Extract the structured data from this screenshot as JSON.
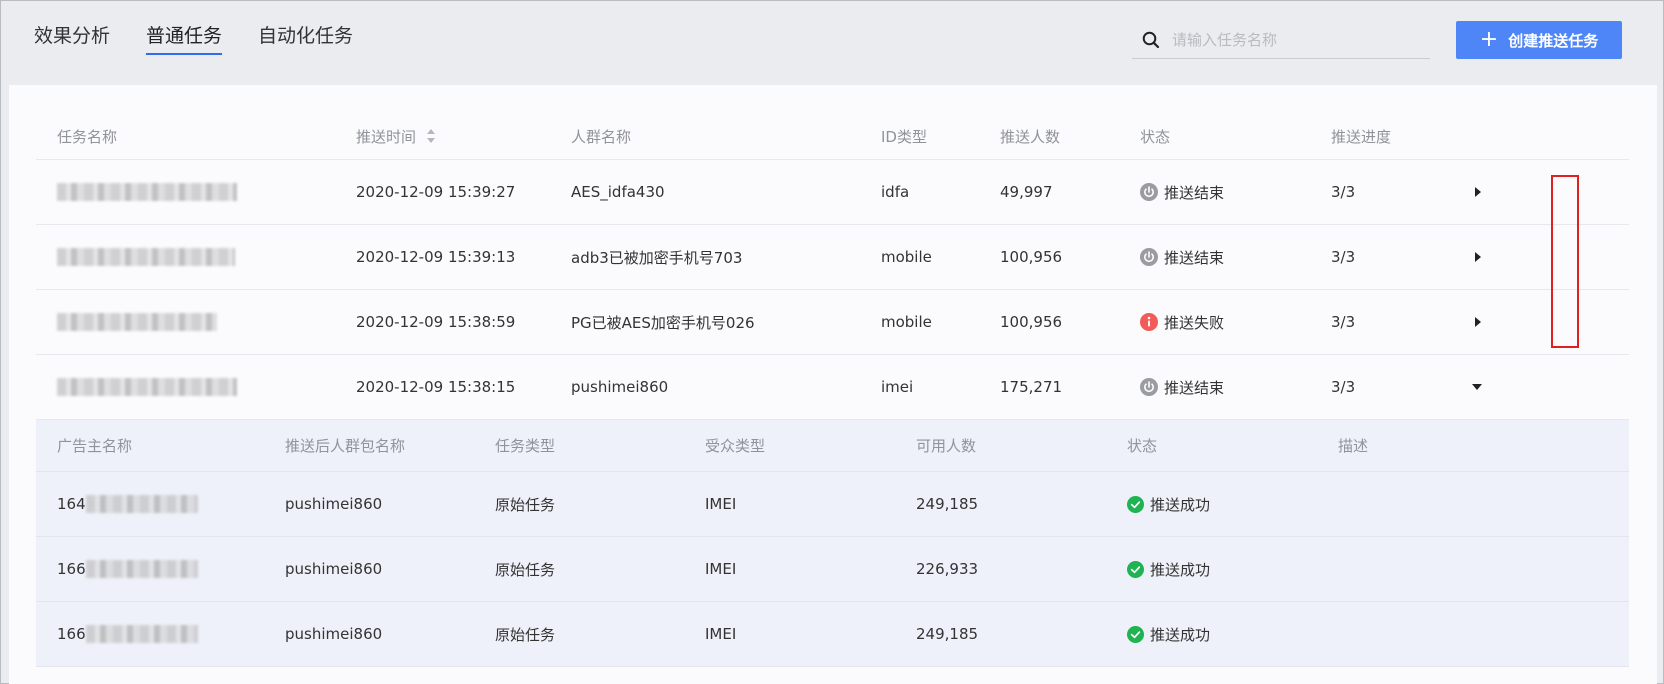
{
  "tabs": [
    {
      "label": "效果分析",
      "active": false
    },
    {
      "label": "普通任务",
      "active": true
    },
    {
      "label": "自动化任务",
      "active": false
    }
  ],
  "search": {
    "placeholder": "请输入任务名称",
    "value": ""
  },
  "create_button": {
    "label": "创建推送任务",
    "icon": "plus-icon"
  },
  "colors": {
    "accent": "#4f86f7",
    "tab_underline": "#2d6cf6",
    "success": "#20b352",
    "fail": "#f35b5b",
    "ended": "#9a9ca1",
    "highlight": "#e02020"
  },
  "table": {
    "headers": [
      "任务名称",
      "推送时间",
      "人群名称",
      "ID类型",
      "推送人数",
      "状态",
      "推送进度"
    ],
    "rows": [
      {
        "name_redacted": true,
        "time": "2020-12-09 15:39:27",
        "audience": "AES_idfa430",
        "id_type": "idfa",
        "count": "49,997",
        "status": "推送结束",
        "status_icon": "power-icon",
        "progress": "3/3",
        "expanded": false
      },
      {
        "name_redacted": true,
        "time": "2020-12-09 15:39:13",
        "audience": "adb3已被加密手机号703",
        "id_type": "mobile",
        "count": "100,956",
        "status": "推送结束",
        "status_icon": "power-icon",
        "progress": "3/3",
        "expanded": false
      },
      {
        "name_redacted": true,
        "time": "2020-12-09 15:38:59",
        "audience": "PG已被AES加密手机号026",
        "id_type": "mobile",
        "count": "100,956",
        "status": "推送失败",
        "status_icon": "error-icon",
        "progress": "3/3",
        "expanded": false
      },
      {
        "name_redacted": true,
        "time": "2020-12-09 15:38:15",
        "audience": "pushimei860",
        "id_type": "imei",
        "count": "175,271",
        "status": "推送结束",
        "status_icon": "power-icon",
        "progress": "3/3",
        "expanded": true
      }
    ]
  },
  "subtable": {
    "headers": [
      "广告主名称",
      "推送后人群包名称",
      "任务类型",
      "受众类型",
      "可用人数",
      "状态",
      "描述"
    ],
    "rows": [
      {
        "advertiser_prefix": "164",
        "package": "pushimei860",
        "task_type": "原始任务",
        "audience_type": "IMEI",
        "available": "249,185",
        "status": "推送成功",
        "desc": ""
      },
      {
        "advertiser_prefix": "166",
        "package": "pushimei860",
        "task_type": "原始任务",
        "audience_type": "IMEI",
        "available": "226,933",
        "status": "推送成功",
        "desc": ""
      },
      {
        "advertiser_prefix": "166",
        "package": "pushimei860",
        "task_type": "原始任务",
        "audience_type": "IMEI",
        "available": "249,185",
        "status": "推送成功",
        "desc": ""
      }
    ]
  }
}
